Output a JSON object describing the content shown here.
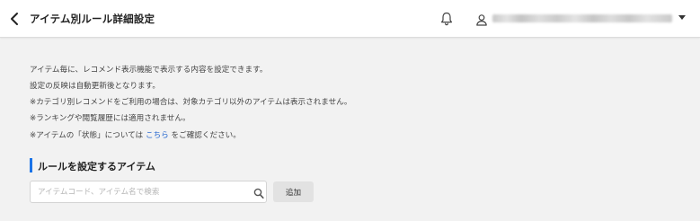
{
  "header": {
    "title": "アイテム別ルール詳細設定",
    "back_icon": "chevron-left-icon",
    "notification_icon": "bell-icon",
    "user_icon": "user-icon",
    "account_dropdown_icon": "caret-down-icon"
  },
  "description": {
    "line1": "アイテム毎に、レコメンド表示機能で表示する内容を設定できます。",
    "line2": "設定の反映は自動更新後となります。",
    "line3": "※カテゴリ別レコメンドをご利用の場合は、対象カテゴリ以外のアイテムは表示されません。",
    "line4": "※ランキングや閲覧履歴には適用されません。",
    "line5_prefix": "※アイテムの「状態」については",
    "line5_link": "こちら",
    "line5_suffix": "をご確認ください。"
  },
  "section": {
    "title": "ルールを設定するアイテム",
    "accent_color": "#1a73e8"
  },
  "search": {
    "placeholder": "アイテムコード、アイテム名で検索",
    "value": "",
    "icon": "search-icon"
  },
  "actions": {
    "add_label": "追加"
  },
  "colors": {
    "background": "#f2f2f2",
    "header_bg": "#ffffff",
    "link": "#2a6ad0"
  }
}
